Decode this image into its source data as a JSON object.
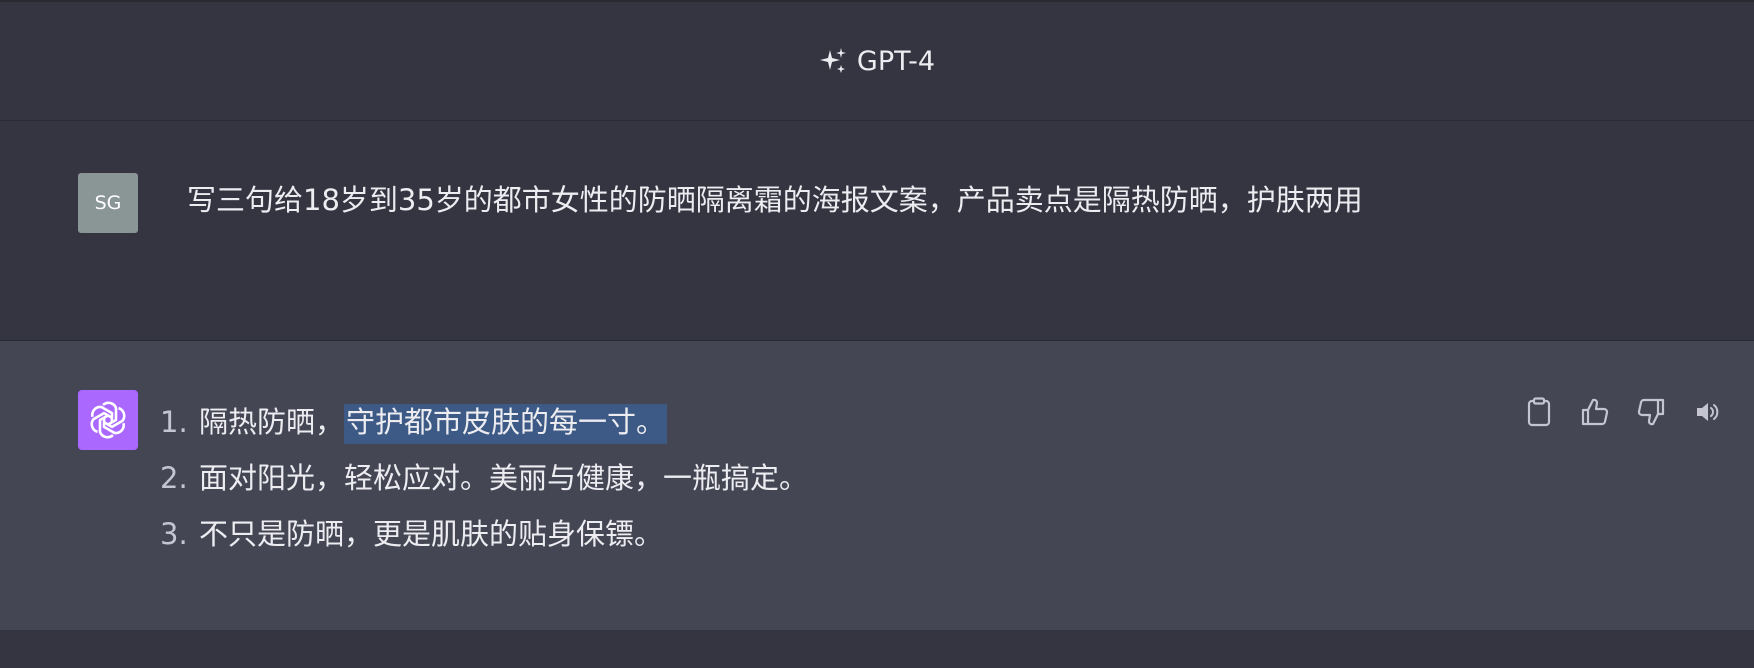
{
  "header": {
    "model_name": "GPT-4",
    "model_icon": "sparkle-icon"
  },
  "user_message": {
    "avatar_initials": "SG",
    "text": "写三句给18岁到35岁的都市女性的防晒隔离霜的海报文案，产品卖点是隔热防晒，护肤两用"
  },
  "assistant_message": {
    "avatar_icon": "openai-logo-icon",
    "items": [
      {
        "number": "1.",
        "text_plain": "隔热防晒，",
        "text_highlighted": "守护都市皮肤的每一寸。"
      },
      {
        "number": "2.",
        "text": "面对阳光，轻松应对。美丽与健康，一瓶搞定。"
      },
      {
        "number": "3.",
        "text": "不只是防晒，更是肌肤的贴身保镖。"
      }
    ],
    "actions": [
      "copy-icon",
      "thumbs-up-icon",
      "thumbs-down-icon",
      "speaker-icon"
    ]
  },
  "colors": {
    "page_bg": "#343541",
    "assistant_bg": "#444654",
    "user_avatar_bg": "#8a9596",
    "gpt_avatar_bg": "#ab68ff",
    "selection_bg": "#3c5a85"
  }
}
